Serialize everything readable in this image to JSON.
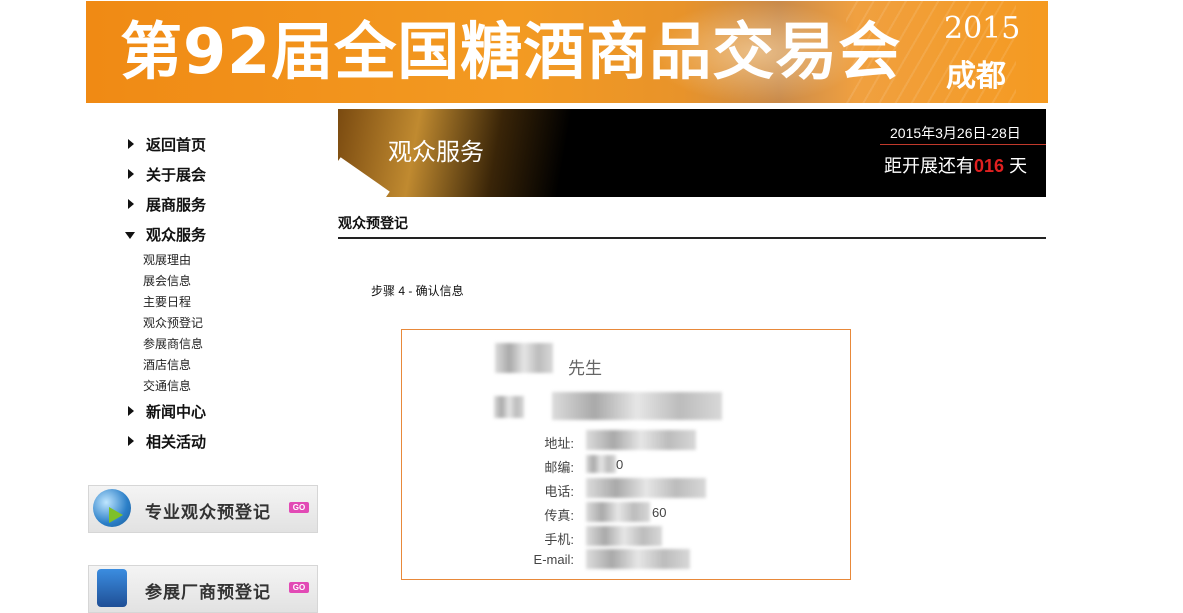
{
  "banner": {
    "title": "第92届全国糖酒商品交易会",
    "year": "2015",
    "city": "成都"
  },
  "sidebar": {
    "items": [
      {
        "label": "返回首页",
        "expanded": false
      },
      {
        "label": "关于展会",
        "expanded": false
      },
      {
        "label": "展商服务",
        "expanded": false
      },
      {
        "label": "观众服务",
        "expanded": true
      },
      {
        "label": "新闻中心",
        "expanded": false
      },
      {
        "label": "相关活动",
        "expanded": false
      }
    ],
    "subitems": [
      "观展理由",
      "展会信息",
      "主要日程",
      "观众预登记",
      "参展商信息",
      "酒店信息",
      "交通信息"
    ],
    "promos": [
      {
        "label": "专业观众预登记",
        "badge": "GO"
      },
      {
        "label": "参展厂商预登记",
        "badge": "GO"
      }
    ]
  },
  "hero": {
    "title": "观众服务",
    "date_range": "2015年3月26日-28日",
    "countdown_prefix": "距开展还有",
    "countdown_days": "016",
    "countdown_suffix": "天"
  },
  "main": {
    "section_title": "观众预登记",
    "step_text": "步骤 4 - 确认信息",
    "card": {
      "name_suffix": "先生",
      "fields": [
        {
          "label": "地址:",
          "value": ""
        },
        {
          "label": "邮编:",
          "value": "0"
        },
        {
          "label": "电话:",
          "value": ""
        },
        {
          "label": "传真:",
          "value": "60"
        },
        {
          "label": "手机:",
          "value": ""
        },
        {
          "label": "E-mail:",
          "value": ""
        }
      ]
    }
  },
  "colors": {
    "banner_orange": "#f39a22",
    "card_border": "#e8893a",
    "countdown_red": "#e02020",
    "promo_badge": "#e24ab5"
  }
}
